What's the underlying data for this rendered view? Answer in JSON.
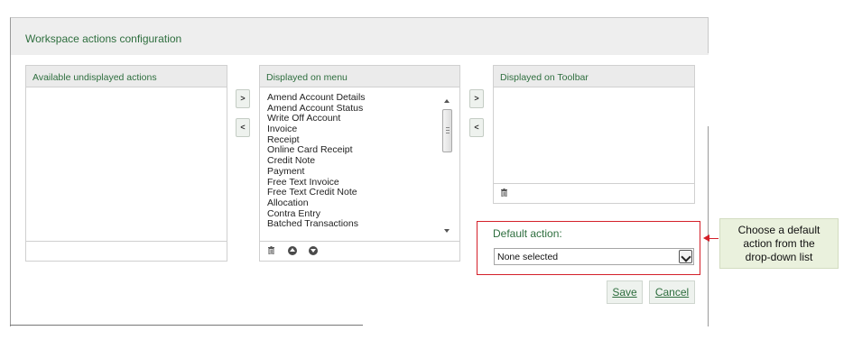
{
  "dialog": {
    "title": "Workspace actions configuration"
  },
  "panels": {
    "available": {
      "title": "Available undisplayed actions",
      "items": []
    },
    "menu": {
      "title": "Displayed on menu",
      "items": [
        "Amend Account Details",
        "Amend Account Status",
        "Write Off Account",
        "Invoice",
        "Receipt",
        "Online Card Receipt",
        "Credit Note",
        "Payment",
        "Free Text Invoice",
        "Free Text Credit Note",
        "Allocation",
        "Contra Entry",
        "Batched Transactions"
      ]
    },
    "toolbar": {
      "title": "Displayed on Toolbar",
      "items": []
    }
  },
  "move_buttons": {
    "add": ">",
    "remove": "<"
  },
  "icons": {
    "delete": "trash-icon",
    "move_up": "circle-up-icon",
    "move_down": "circle-down-icon"
  },
  "default_action": {
    "label": "Default action:",
    "selected": "None selected"
  },
  "buttons": {
    "save": "Save",
    "cancel": "Cancel"
  },
  "callout": {
    "text_lines": [
      "Choose a default",
      "action from the",
      "drop-down list"
    ]
  },
  "colors": {
    "accent_green": "#2e6e3e",
    "callout_border_red": "#d4202a",
    "callout_bg": "#eaf1dd"
  }
}
